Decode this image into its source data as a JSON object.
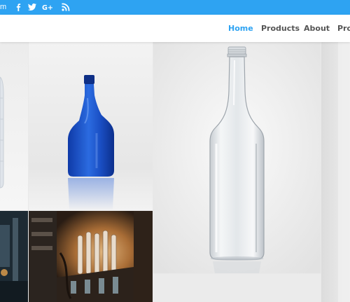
{
  "topbar": {
    "email_tail": "m",
    "social_icons": [
      "facebook-icon",
      "twitter-icon",
      "google-plus-icon",
      "rss-icon"
    ],
    "background": "#2ea3f2"
  },
  "header": {
    "nav": [
      {
        "label": "Home",
        "active": true
      },
      {
        "label": "Products",
        "active": false
      },
      {
        "label": "About",
        "active": false
      },
      {
        "label": "Prod",
        "active": false
      }
    ]
  },
  "colors": {
    "accent": "#2ea3f2",
    "nav_text": "#555555",
    "cobalt_bottle": "#1a4fc4"
  },
  "gallery": {
    "tiles": [
      {
        "name": "partial-bottle-photo"
      },
      {
        "name": "blue-spray-bottle-photo"
      },
      {
        "name": "clear-glass-bottle-photo"
      },
      {
        "name": "partial-right-photo"
      },
      {
        "name": "factory-dark-photo"
      },
      {
        "name": "bottle-molding-machine-photo"
      }
    ]
  }
}
